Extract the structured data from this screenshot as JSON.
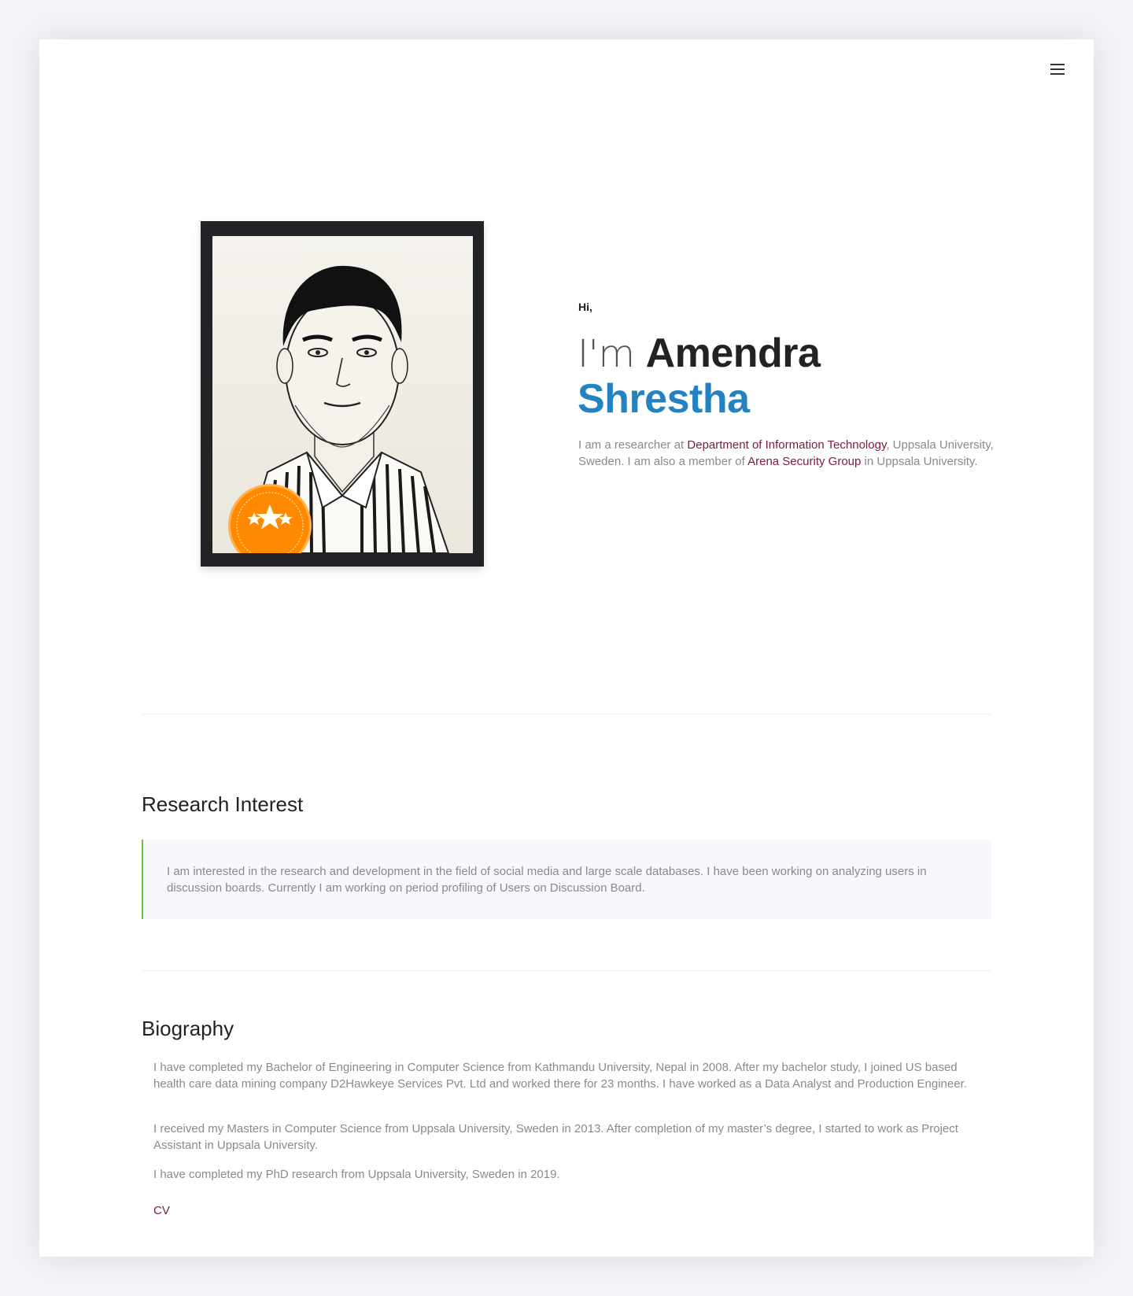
{
  "header": {
    "menu_icon": "hamburger-menu-icon"
  },
  "hero": {
    "greeting": "Hi,",
    "im": "I'm",
    "first_name": "Amendra",
    "last_name": "Shrestha",
    "intro_prefix": "I am a researcher at ",
    "dept_link": "Department of Information Technology",
    "intro_middle": ", Uppsala University, Sweden. I am also a member of ",
    "group_link": "Arena Security Group",
    "intro_suffix": " in Uppsala University.",
    "badge_icon": "three-stars-badge-icon",
    "colors": {
      "last_name": "#2482c1",
      "link": "#7b1c3a",
      "badge": "#ff8a00",
      "quote_border": "#6bbf3a"
    }
  },
  "research": {
    "title": "Research Interest",
    "text": "I am interested in the research and development in the field of social media and large scale databases. I have been working on analyzing users in discussion boards. Currently I am working on period profiling of Users on Discussion Board."
  },
  "biography": {
    "title": "Biography",
    "paragraphs": [
      "I have completed my Bachelor of Engineering in Computer Science from Kathmandu University, Nepal in 2008. After my bachelor study, I joined US based health care data mining company D2Hawkeye Services Pvt. Ltd and worked there for 23 months. I have worked as a Data Analyst and Production Engineer.",
      "I received my Masters in Computer Science from Uppsala University, Sweden in 2013. After completion of my master’s degree, I started to work as Project Assistant in Uppsala University.",
      "I have completed my PhD research from Uppsala University, Sweden in 2019."
    ],
    "cv_link": "CV"
  }
}
